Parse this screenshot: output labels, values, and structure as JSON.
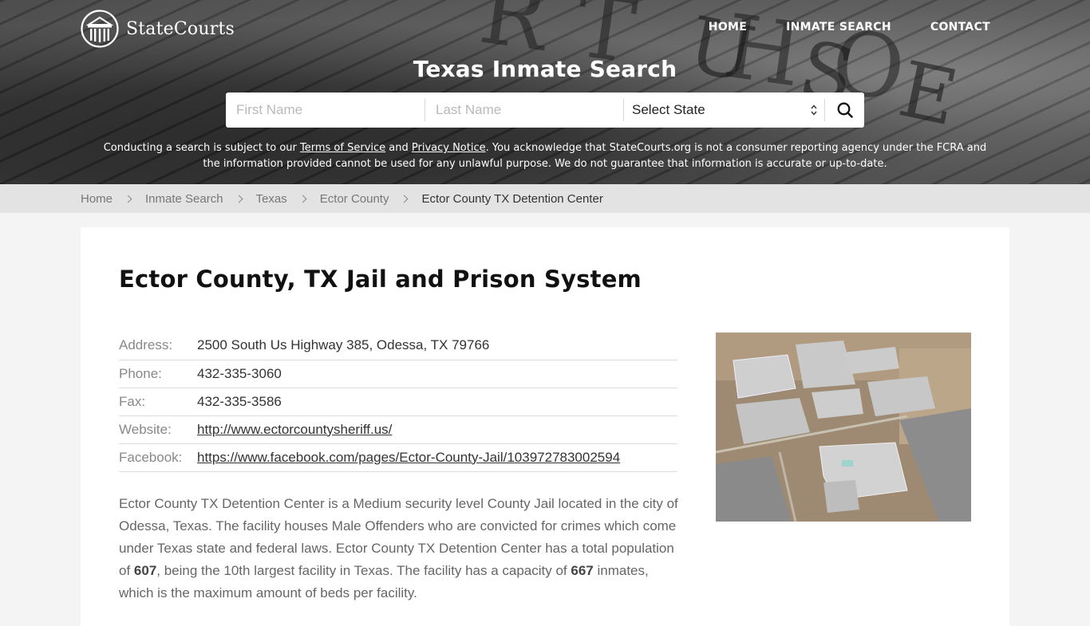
{
  "brand": {
    "name": "StateCourts",
    "icon": "courthouse-columns-icon"
  },
  "nav": {
    "items": [
      {
        "label": "HOME"
      },
      {
        "label": "INMATE SEARCH"
      },
      {
        "label": "CONTACT"
      }
    ]
  },
  "hero": {
    "title": "Texas Inmate Search",
    "background_text_1": "RT HO",
    "background_text_2": "USE"
  },
  "search": {
    "first_name_placeholder": "First Name",
    "last_name_placeholder": "Last Name",
    "state_selected": "Select State",
    "search_icon": "search-icon"
  },
  "disclaimer": {
    "part1": "Conducting a search is subject to our ",
    "terms_link": "Terms of Service",
    "part2": " and ",
    "privacy_link": "Privacy Notice",
    "part3": ". You acknowledge that StateCourts.org is not a consumer reporting agency under the FCRA and the information provided cannot be used for any unlawful purpose. We do not guarantee that information is accurate or up-to-date."
  },
  "breadcrumb": [
    {
      "label": "Home"
    },
    {
      "label": "Inmate Search"
    },
    {
      "label": "Texas"
    },
    {
      "label": "Ector County"
    },
    {
      "label": "Ector County TX Detention Center"
    }
  ],
  "page": {
    "title": "Ector County, TX Jail and Prison System",
    "info": [
      {
        "label": "Address:",
        "value": "2500 South Us Highway 385, Odessa, TX 79766",
        "link": false
      },
      {
        "label": "Phone:",
        "value": "432-335-3060",
        "link": false
      },
      {
        "label": "Fax:",
        "value": "432-335-3586",
        "link": false
      },
      {
        "label": "Website:",
        "value": "http://www.ectorcountysheriff.us/",
        "link": true
      },
      {
        "label": "Facebook:",
        "value": "https://www.facebook.com/pages/Ector-County-Jail/103972783002594",
        "link": true
      }
    ],
    "photo_alt": "Aerial view of Ector County TX Detention Center",
    "description": {
      "s1": "Ector County TX Detention Center is a Medium security level County Jail located in the city of Odessa, Texas. The facility houses Male Offenders who are convicted for crimes which come under Texas state and federal laws. Ector County TX Detention Center has a total population of ",
      "population": "607",
      "s2": ", being the 10th largest facility in Texas. The facility has a capacity of ",
      "capacity": "667",
      "s3": " inmates, which is the maximum amount of beds per facility."
    }
  }
}
